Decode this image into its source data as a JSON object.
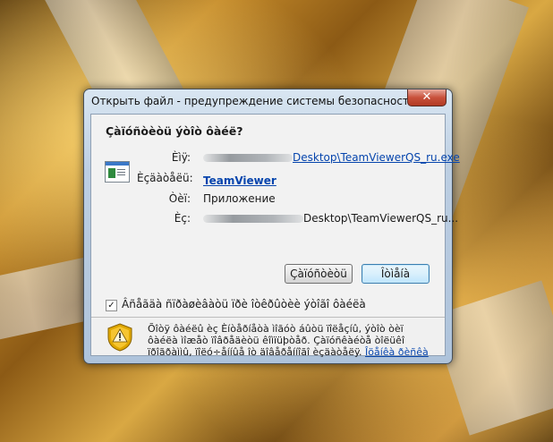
{
  "window": {
    "title": "Открыть файл - предупреждение системы безопасности",
    "close_glyph": "✕"
  },
  "question": "Çàïóñòèòü ýòîò ôàéë?",
  "fields": [
    {
      "label": "Èìÿ:",
      "value": "Desktop\\TeamViewerQS_ru.exe"
    },
    {
      "label": "Èçäàòåëü:",
      "value": "TeamViewer"
    },
    {
      "label": "Òèï:",
      "value": "Приложение"
    },
    {
      "label": "Èç:",
      "value": "Desktop\\TeamViewerQS_ru..."
    }
  ],
  "buttons": {
    "run": "Çàïóñòèòü",
    "cancel": "Îòìåíà"
  },
  "checkbox": {
    "checked": true,
    "label": "Âñåãäà ñïðàøèâàòü ïðè îòêðûòèè ýòîãî ôàéëà"
  },
  "warning": {
    "text": "Õîòÿ ôàéëû èç Èíòåðíåòà ìîãóò áûòü ïîëåçíû, ýòîò òèï ôàéëà ìîæåò ïîâðåäèòü êîìïüþòåð. Çàïóñêàéòå òîëüêî ïðîãðàììû, ïîëó÷åííûå îò äîâåðåííîãî èçäàòåëÿ.",
    "link": "Îöåíêà ðèñêà"
  },
  "icons": {
    "file": "application-file-icon",
    "warning": "security-shield-warning-icon"
  },
  "colors": {
    "link": "#0645ad",
    "close_button": "#c8513b",
    "default_button_border": "#3c7fb1"
  }
}
